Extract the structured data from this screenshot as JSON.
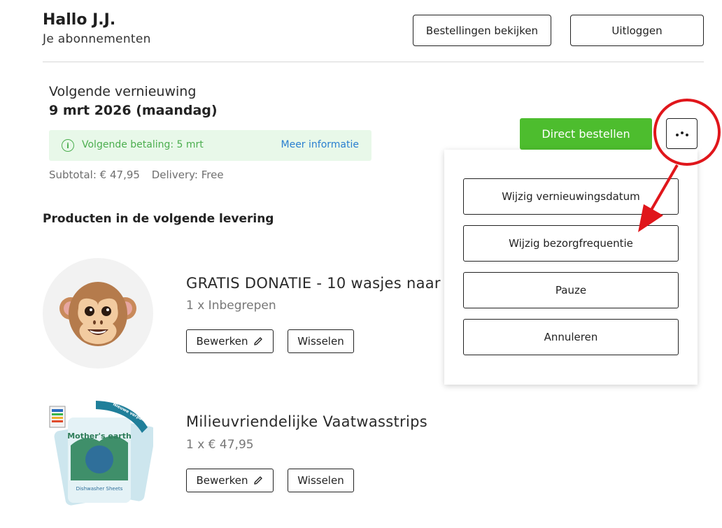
{
  "header": {
    "greeting": "Hallo J.J.",
    "subtitle": "Je abonnementen",
    "orders_button": "Bestellingen bekijken",
    "logout_button": "Uitloggen"
  },
  "renewal": {
    "label": "Volgende vernieuwing",
    "date": "9 mrt 2026 (maandag)",
    "info_text": "Volgende betaling: 5 mrt",
    "info_link": "Meer informatie",
    "subtotal": "Subtotal: € 47,95",
    "delivery": "Delivery: Free"
  },
  "actions": {
    "order_now": "Direct bestellen",
    "more_icon": "more-dots-icon"
  },
  "menu": {
    "items": [
      {
        "label": "Wijzig vernieuwingsdatum"
      },
      {
        "label": "Wijzig bezorgfrequentie"
      },
      {
        "label": "Pauze"
      },
      {
        "label": "Annuleren"
      }
    ]
  },
  "products_section_title": "Producten in de volgende levering",
  "products": [
    {
      "name": "GRATIS DONATIE - 10 wasjes naar",
      "qty": "1 x Inbegrepen",
      "edit_label": "Bewerken",
      "swap_label": "Wisselen",
      "image": "monkey-emoji-image"
    },
    {
      "name": "Milieuvriendelijke Vaatwasstrips",
      "qty": "1 x € 47,95",
      "edit_label": "Bewerken",
      "swap_label": "Wisselen",
      "image": "dishwasher-sheets-package-image",
      "image_text": {
        "brand": "Mother's earth",
        "ribbon": "Nieuwe verpakking",
        "product": "Dishwasher Sheets"
      }
    }
  ],
  "colors": {
    "primary_green": "#4dbd2e",
    "info_bg": "#e8f8e9",
    "info_text": "#4cae4f",
    "link_blue": "#2a7fd0",
    "annotation_red": "#e0161b"
  }
}
